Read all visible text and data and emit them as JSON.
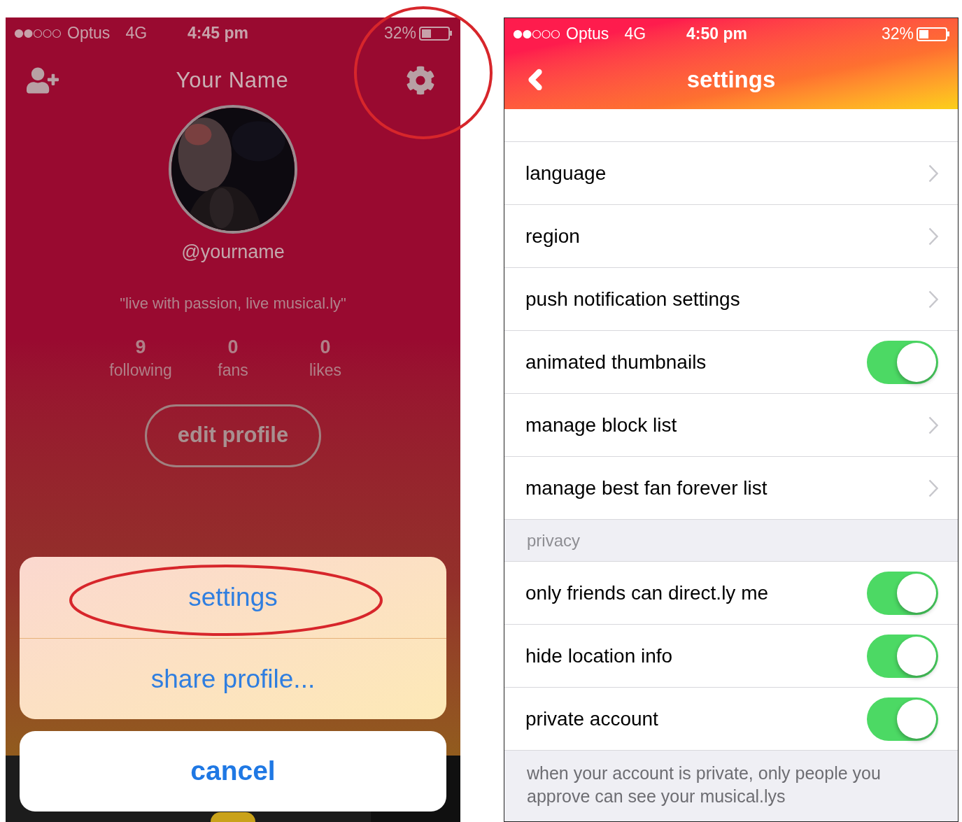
{
  "left_phone": {
    "status_bar": {
      "carrier": "Optus",
      "network": "4G",
      "time": "4:45 pm",
      "battery": "32%"
    },
    "title": "Your Name",
    "username": "@yourname",
    "bio": "\"live with passion, live musical.ly\"",
    "stats": [
      {
        "value": "9",
        "label": "following"
      },
      {
        "value": "0",
        "label": "fans"
      },
      {
        "value": "0",
        "label": "likes"
      }
    ],
    "edit_button": "edit profile",
    "action_sheet": {
      "items": [
        "settings",
        "share profile..."
      ],
      "cancel": "cancel"
    }
  },
  "right_phone": {
    "status_bar": {
      "carrier": "Optus",
      "network": "4G",
      "time": "4:50 pm",
      "battery": "32%"
    },
    "title": "settings",
    "sections": [
      {
        "rows": [
          {
            "label": "language",
            "kind": "link"
          },
          {
            "label": "region",
            "kind": "link"
          },
          {
            "label": "push notification settings",
            "kind": "link"
          },
          {
            "label": "animated thumbnails",
            "kind": "toggle",
            "on": true
          },
          {
            "label": "manage block list",
            "kind": "link"
          },
          {
            "label": "manage best fan forever list",
            "kind": "link"
          }
        ]
      },
      {
        "header": "privacy",
        "rows": [
          {
            "label": "only friends can direct.ly me",
            "kind": "toggle",
            "on": true
          },
          {
            "label": "hide location info",
            "kind": "toggle",
            "on": true
          },
          {
            "label": "private account",
            "kind": "toggle",
            "on": true
          }
        ],
        "footer": "when your account is private, only people you approve can see your musical.lys"
      }
    ]
  }
}
